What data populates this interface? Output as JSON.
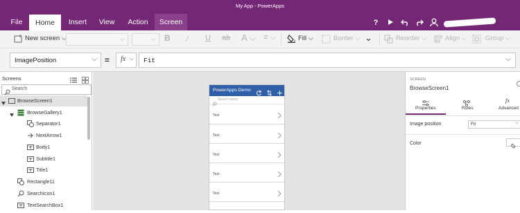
{
  "window": {
    "title": "My App - PowerApps"
  },
  "tabs": [
    "File",
    "Home",
    "Insert",
    "View",
    "Action",
    "Screen"
  ],
  "toolbar": {
    "new_screen": "New screen",
    "fill": "Fill",
    "border": "Border",
    "reorder": "Reorder",
    "align": "Align",
    "group": "Group"
  },
  "formula": {
    "property": "ImagePosition",
    "equals": "=",
    "fx": "fx",
    "value": "Fit"
  },
  "left_panel": {
    "title": "Screens",
    "search_placeholder": "Search",
    "tree": [
      {
        "label": "BrowseScreen1",
        "icon": "screen-icon",
        "level": 0
      },
      {
        "label": "BrowseGallery1",
        "icon": "gallery-icon",
        "level": 1
      },
      {
        "label": "Separator1",
        "icon": "shape-icon",
        "level": 2
      },
      {
        "label": "NextArrow1",
        "icon": "arrow-icon",
        "level": 2
      },
      {
        "label": "Body1",
        "icon": "label-icon",
        "level": 2
      },
      {
        "label": "Subtitle1",
        "icon": "label-icon",
        "level": 2
      },
      {
        "label": "Title1",
        "icon": "label-icon",
        "level": 2
      },
      {
        "label": "Rectangle11",
        "icon": "shape-icon",
        "level": 1
      },
      {
        "label": "SearchIcon1",
        "icon": "search-icon",
        "level": 1
      },
      {
        "label": "TextSearchBox1",
        "icon": "label-icon",
        "level": 1
      }
    ]
  },
  "phone": {
    "header_title": "PowerApps Demo",
    "search_placeholder": "Search items",
    "item_text": "Text",
    "accent": "#2f5fa6"
  },
  "right_panel": {
    "section": "SCREEN",
    "screen_name": "BrowseScreen1",
    "tabs": [
      "Properties",
      "Rules",
      "Advanced"
    ],
    "image_position_label": "Image position",
    "image_position_value": "Fit",
    "color_label": "Color"
  },
  "colors": {
    "brand": "#742774"
  }
}
